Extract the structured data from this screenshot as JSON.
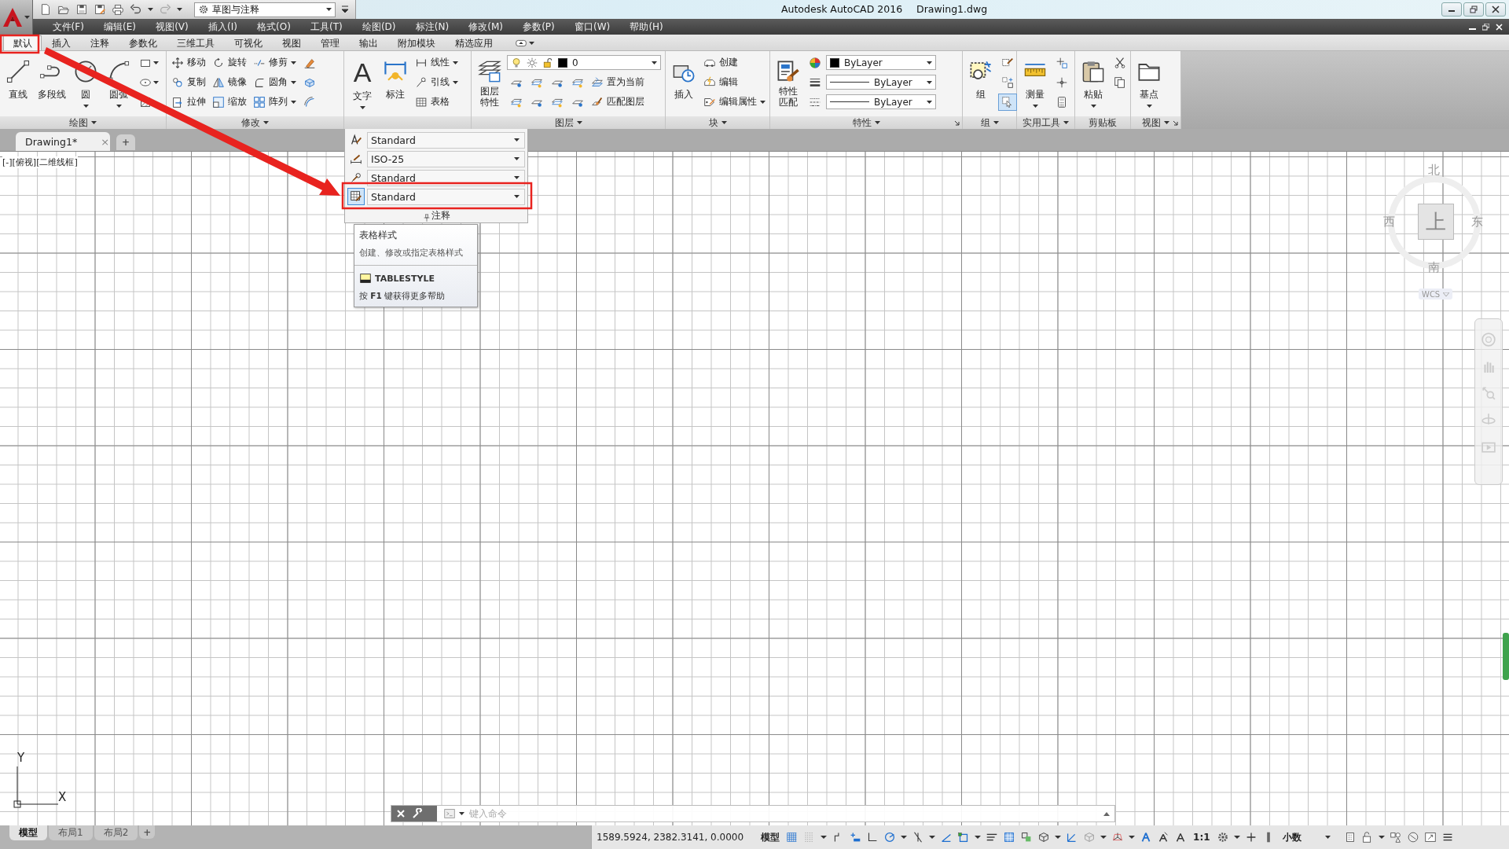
{
  "title_bar": {
    "workspace": "草图与注释",
    "app_title": "Autodesk AutoCAD 2016",
    "document_title": "Drawing1.dwg"
  },
  "menu_bar": [
    "文件(F)",
    "编辑(E)",
    "视图(V)",
    "插入(I)",
    "格式(O)",
    "工具(T)",
    "绘图(D)",
    "标注(N)",
    "修改(M)",
    "参数(P)",
    "窗口(W)",
    "帮助(H)"
  ],
  "ribbon_tabs": [
    {
      "label": "默认",
      "selected": true
    },
    {
      "label": "插入",
      "selected": false
    },
    {
      "label": "注释",
      "selected": false
    },
    {
      "label": "参数化",
      "selected": false
    },
    {
      "label": "三维工具",
      "selected": false
    },
    {
      "label": "可视化",
      "selected": false
    },
    {
      "label": "视图",
      "selected": false
    },
    {
      "label": "管理",
      "selected": false
    },
    {
      "label": "输出",
      "selected": false
    },
    {
      "label": "附加模块",
      "selected": false
    },
    {
      "label": "精选应用",
      "selected": false
    }
  ],
  "ribbon_panels": [
    {
      "title": "绘图",
      "menu": true,
      "launcher": false,
      "expanded": false,
      "columns": [
        [
          [
            {
              "kind": "large",
              "label": "直线",
              "menu": false
            }
          ]
        ],
        [
          [
            {
              "kind": "large",
              "label": "多段线",
              "menu": false
            }
          ]
        ],
        [
          [
            {
              "kind": "large",
              "label": "圆",
              "menu": true
            }
          ]
        ],
        [
          [
            {
              "kind": "large",
              "label": "圆弧",
              "menu": true
            }
          ]
        ],
        [
          [
            {
              "kind": "icon",
              "menu": true,
              "on": false
            }
          ],
          [
            {
              "kind": "icon",
              "menu": true,
              "on": false
            }
          ],
          [
            {
              "kind": "icon",
              "menu": false,
              "on": false
            }
          ]
        ]
      ]
    },
    {
      "title": "修改",
      "menu": true,
      "launcher": false,
      "expanded": false,
      "columns": [
        [
          [
            {
              "kind": "small",
              "label": "移动",
              "menu": false
            }
          ],
          [
            {
              "kind": "small",
              "label": "复制",
              "menu": false
            }
          ],
          [
            {
              "kind": "small",
              "label": "拉伸",
              "menu": false
            }
          ]
        ],
        [
          [
            {
              "kind": "small",
              "label": "旋转",
              "menu": false
            }
          ],
          [
            {
              "kind": "small",
              "label": "镜像",
              "menu": false
            }
          ],
          [
            {
              "kind": "small",
              "label": "缩放",
              "menu": false
            }
          ]
        ],
        [
          [
            {
              "kind": "small",
              "label": "修剪",
              "menu": true
            }
          ],
          [
            {
              "kind": "small",
              "label": "圆角",
              "menu": true
            }
          ],
          [
            {
              "kind": "small",
              "label": "阵列",
              "menu": true
            }
          ]
        ],
        [
          [
            {
              "kind": "icon",
              "menu": false,
              "on": false
            }
          ],
          [
            {
              "kind": "icon",
              "menu": false,
              "on": false
            }
          ],
          [
            {
              "kind": "icon",
              "menu": false,
              "on": false
            }
          ]
        ]
      ]
    },
    {
      "title": "注释",
      "menu": false,
      "launcher": false,
      "expanded": true,
      "columns": [
        [
          [
            {
              "kind": "large",
              "label": "文字",
              "glyph": "A",
              "menu": true
            }
          ]
        ],
        [
          [
            {
              "kind": "large",
              "label": "标注",
              "menu": false
            }
          ]
        ],
        [
          [
            {
              "kind": "small",
              "label": "线性",
              "menu": true
            }
          ],
          [
            {
              "kind": "small",
              "label": "引线",
              "menu": true
            }
          ],
          [
            {
              "kind": "small",
              "label": "表格",
              "menu": false
            }
          ]
        ]
      ],
      "slideout": [
        {
          "value": "Standard",
          "selected": false
        },
        {
          "value": "ISO-25",
          "selected": false
        },
        {
          "value": "Standard",
          "selected": false
        },
        {
          "value": "Standard",
          "selected": true
        }
      ]
    },
    {
      "title": "图层",
      "menu": true,
      "launcher": false,
      "expanded": false,
      "columns": [
        [
          [
            {
              "kind": "large",
              "label": "图层特性",
              "narrow": true,
              "menu": false
            }
          ]
        ],
        [
          [
            {
              "kind": "layer_combo",
              "value": "0"
            }
          ],
          [
            {
              "kind": "icon",
              "menu": false,
              "on": false
            },
            {
              "kind": "icon",
              "menu": false,
              "on": false
            },
            {
              "kind": "icon",
              "menu": false,
              "on": false
            },
            {
              "kind": "icon",
              "menu": false,
              "on": false
            },
            {
              "kind": "small",
              "label": "置为当前",
              "menu": false
            }
          ],
          [
            {
              "kind": "icon",
              "menu": false,
              "on": false
            },
            {
              "kind": "icon",
              "menu": false,
              "on": false
            },
            {
              "kind": "icon",
              "menu": false,
              "on": false
            },
            {
              "kind": "icon",
              "menu": false,
              "on": false
            },
            {
              "kind": "small",
              "label": "匹配图层",
              "menu": false
            }
          ]
        ]
      ]
    },
    {
      "title": "块",
      "menu": true,
      "launcher": false,
      "expanded": false,
      "columns": [
        [
          [
            {
              "kind": "large",
              "label": "插入",
              "menu": false
            }
          ]
        ],
        [
          [
            {
              "kind": "small",
              "label": "创建",
              "menu": false
            }
          ],
          [
            {
              "kind": "small",
              "label": "编辑",
              "menu": false
            }
          ],
          [
            {
              "kind": "small",
              "label": "编辑属性",
              "menu": true
            }
          ]
        ]
      ]
    },
    {
      "title": "特性",
      "menu": true,
      "launcher": true,
      "expanded": false,
      "columns": [
        [
          [
            {
              "kind": "large",
              "label": "特性匹配",
              "narrow": true,
              "menu": false
            }
          ]
        ],
        [
          [
            {
              "kind": "icon",
              "menu": false,
              "on": false
            }
          ],
          [
            {
              "kind": "icon",
              "menu": false,
              "on": false
            }
          ],
          [
            {
              "kind": "icon",
              "menu": false,
              "on": false
            }
          ]
        ],
        [
          [
            {
              "kind": "color_combo",
              "value": "ByLayer"
            }
          ],
          [
            {
              "kind": "linetype_combo",
              "value": "ByLayer"
            }
          ],
          [
            {
              "kind": "linetype_combo",
              "value": "ByLayer"
            }
          ]
        ]
      ]
    },
    {
      "title": "组",
      "menu": true,
      "launcher": false,
      "expanded": false,
      "columns": [
        [
          [
            {
              "kind": "large",
              "label": "组",
              "menu": false
            }
          ]
        ],
        [
          [
            {
              "kind": "icon",
              "menu": false,
              "on": false
            }
          ],
          [
            {
              "kind": "icon",
              "menu": false,
              "on": false
            }
          ],
          [
            {
              "kind": "icon",
              "menu": false,
              "on": true
            }
          ]
        ]
      ]
    },
    {
      "title": "实用工具",
      "menu": true,
      "launcher": false,
      "expanded": false,
      "columns": [
        [
          [
            {
              "kind": "large",
              "label": "测量",
              "menu": true
            }
          ]
        ],
        [
          [
            {
              "kind": "icon",
              "menu": false,
              "on": false
            }
          ],
          [
            {
              "kind": "icon",
              "menu": false,
              "on": false
            }
          ],
          [
            {
              "kind": "icon",
              "menu": false,
              "on": false
            }
          ]
        ]
      ]
    },
    {
      "title": "剪贴板",
      "menu": false,
      "launcher": false,
      "expanded": false,
      "columns": [
        [
          [
            {
              "kind": "large",
              "label": "粘贴",
              "menu": true
            }
          ]
        ],
        [
          [
            {
              "kind": "icon",
              "menu": false,
              "on": false
            }
          ],
          [
            {
              "kind": "icon",
              "menu": false,
              "on": false
            }
          ]
        ]
      ]
    },
    {
      "title": "视图",
      "menu": true,
      "launcher": true,
      "expanded": false,
      "columns": [
        [
          [
            {
              "kind": "large",
              "label": "基点",
              "menu": true
            }
          ]
        ]
      ]
    }
  ],
  "tooltip": {
    "title": "表格样式",
    "description": "创建、修改或指定表格样式",
    "command": "TABLESTYLE",
    "help": "按 **F1** 键获得更多帮助"
  },
  "document_tabs": [
    {
      "label": "Drawing1*",
      "selected": true,
      "close": "×"
    }
  ],
  "new_tab": "+",
  "viewport_label": "[-][俯视][二维线框]",
  "view_cube": {
    "north": "北",
    "south": "南",
    "west": "西",
    "east": "东",
    "top": "上",
    "ucs": "WCS"
  },
  "ucs_icon": {
    "x": "X",
    "y": "Y"
  },
  "command_line": {
    "placeholder": "键入命令"
  },
  "layout_tabs": [
    {
      "label": "模型",
      "selected": true
    },
    {
      "label": "布局1",
      "selected": false
    },
    {
      "label": "布局2",
      "selected": false
    }
  ],
  "new_layout": "+",
  "status_bar": {
    "coordinates": "1589.5924, 2382.3141, 0.0000",
    "space": "模型",
    "annotation_scale": "1:1",
    "units": "小数"
  }
}
